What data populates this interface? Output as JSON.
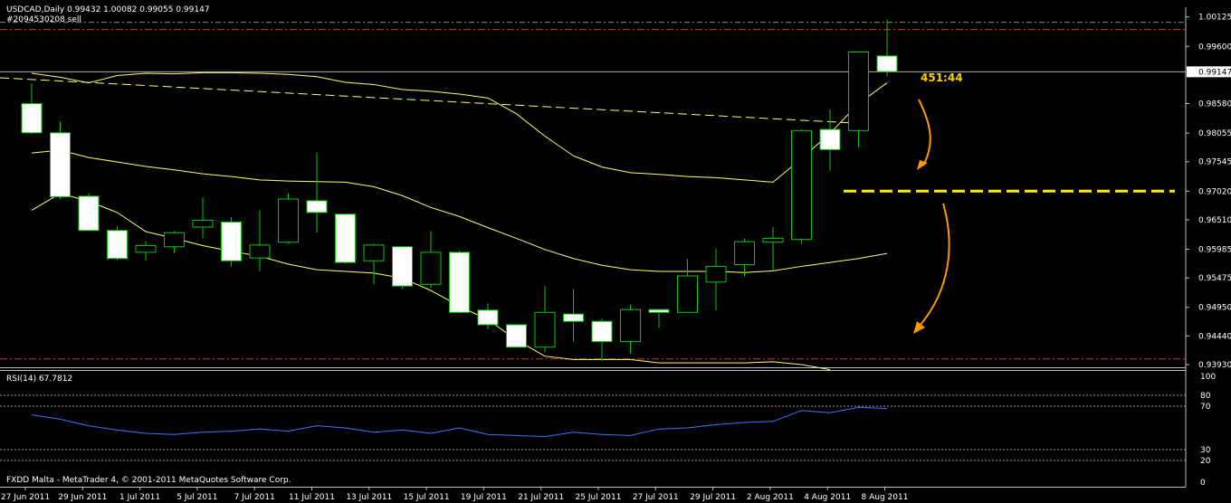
{
  "header": {
    "symbol_line": "USDCAD,Daily  0.99432 1.00082 0.99055 0.99147",
    "order_line": "#2094530208 sell"
  },
  "annotation": {
    "countdown": "451:44"
  },
  "footer": {
    "copyright": "FXDD Malta - MetaTrader 4, © 2001-2011 MetaQuotes Software Corp."
  },
  "rsi": {
    "label": "RSI(14) 67.7812"
  },
  "colors": {
    "background": "#000000",
    "bull_outline": "#00c800",
    "bear_fill": "#ffffff",
    "bands": "#ffff66",
    "levels_red": "#d03030",
    "arrows": "#ff9900",
    "rsi_line": "#3a74ff",
    "countdown": "#ffcc00"
  },
  "chart_data": [
    {
      "type": "candlestick",
      "title": "USDCAD,Daily",
      "ylim": [
        0.9393,
        1.0012
      ],
      "y_ticks": [
        "1.00125",
        "0.99600",
        "0.99147",
        "0.98580",
        "0.98055",
        "0.97545",
        "0.97020",
        "0.96510",
        "0.95985",
        "0.95475",
        "0.94950",
        "0.94440",
        "0.93930"
      ],
      "current_price": 0.99147,
      "x_tick_labels": [
        "27 Jun 2011",
        "29 Jun 2011",
        "1 Jul 2011",
        "5 Jul 2011",
        "7 Jul 2011",
        "11 Jul 2011",
        "13 Jul 2011",
        "15 Jul 2011",
        "19 Jul 2011",
        "21 Jul 2011",
        "25 Jul 2011",
        "27 Jul 2011",
        "29 Jul 2011",
        "2 Aug 2011",
        "4 Aug 2011",
        "8 Aug 2011"
      ],
      "candles": [
        {
          "o": 0.9858,
          "h": 0.9894,
          "l": 0.9804,
          "c": 0.9806
        },
        {
          "o": 0.9806,
          "h": 0.9826,
          "l": 0.9688,
          "c": 0.9692
        },
        {
          "o": 0.9693,
          "h": 0.9698,
          "l": 0.9631,
          "c": 0.9632
        },
        {
          "o": 0.9632,
          "h": 0.964,
          "l": 0.9579,
          "c": 0.9582
        },
        {
          "o": 0.9593,
          "h": 0.9613,
          "l": 0.9578,
          "c": 0.9605
        },
        {
          "o": 0.9603,
          "h": 0.9631,
          "l": 0.9592,
          "c": 0.9628
        },
        {
          "o": 0.9638,
          "h": 0.9691,
          "l": 0.9618,
          "c": 0.965
        },
        {
          "o": 0.9647,
          "h": 0.9656,
          "l": 0.9568,
          "c": 0.9578
        },
        {
          "o": 0.9583,
          "h": 0.9668,
          "l": 0.9559,
          "c": 0.9606
        },
        {
          "o": 0.9611,
          "h": 0.9698,
          "l": 0.9608,
          "c": 0.9688
        },
        {
          "o": 0.9685,
          "h": 0.9771,
          "l": 0.9628,
          "c": 0.9664
        },
        {
          "o": 0.9661,
          "h": 0.9661,
          "l": 0.9573,
          "c": 0.9575
        },
        {
          "o": 0.9578,
          "h": 0.9608,
          "l": 0.9536,
          "c": 0.9606
        },
        {
          "o": 0.9603,
          "h": 0.9603,
          "l": 0.9528,
          "c": 0.9533
        },
        {
          "o": 0.9536,
          "h": 0.9631,
          "l": 0.9529,
          "c": 0.9593
        },
        {
          "o": 0.9593,
          "h": 0.9596,
          "l": 0.9484,
          "c": 0.9486
        },
        {
          "o": 0.949,
          "h": 0.9502,
          "l": 0.9456,
          "c": 0.9464
        },
        {
          "o": 0.9464,
          "h": 0.9464,
          "l": 0.9424,
          "c": 0.9424
        },
        {
          "o": 0.9424,
          "h": 0.9533,
          "l": 0.9415,
          "c": 0.9486
        },
        {
          "o": 0.9483,
          "h": 0.9528,
          "l": 0.9434,
          "c": 0.947
        },
        {
          "o": 0.947,
          "h": 0.9475,
          "l": 0.94,
          "c": 0.9434
        },
        {
          "o": 0.9434,
          "h": 0.95,
          "l": 0.9413,
          "c": 0.9491
        },
        {
          "o": 0.9491,
          "h": 0.9491,
          "l": 0.9458,
          "c": 0.9486
        },
        {
          "o": 0.9486,
          "h": 0.9581,
          "l": 0.9486,
          "c": 0.9551
        },
        {
          "o": 0.954,
          "h": 0.96,
          "l": 0.949,
          "c": 0.9568
        },
        {
          "o": 0.9571,
          "h": 0.9618,
          "l": 0.955,
          "c": 0.9612
        },
        {
          "o": 0.9611,
          "h": 0.9638,
          "l": 0.9561,
          "c": 0.9618
        },
        {
          "o": 0.9616,
          "h": 0.9812,
          "l": 0.9608,
          "c": 0.981
        },
        {
          "o": 0.9812,
          "h": 0.9848,
          "l": 0.9738,
          "c": 0.9776
        },
        {
          "o": 0.981,
          "h": 0.995,
          "l": 0.978,
          "c": 0.995
        },
        {
          "o": 0.9943,
          "h": 1.0008,
          "l": 0.9906,
          "c": 0.9915
        }
      ],
      "upper_band": [
        0.9912,
        0.9905,
        0.9895,
        0.9908,
        0.9912,
        0.9911,
        0.9913,
        0.9913,
        0.9912,
        0.991,
        0.9906,
        0.9896,
        0.9892,
        0.9883,
        0.988,
        0.9875,
        0.9868,
        0.984,
        0.98,
        0.9765,
        0.9745,
        0.9735,
        0.9732,
        0.9728,
        0.9726,
        0.9722,
        0.9718,
        0.976,
        0.9805,
        0.9858,
        0.9895
      ],
      "middle_band": [
        0.977,
        0.9775,
        0.9762,
        0.9754,
        0.9746,
        0.974,
        0.9733,
        0.9728,
        0.9722,
        0.972,
        0.9719,
        0.9718,
        0.971,
        0.9694,
        0.9673,
        0.9657,
        0.9637,
        0.9618,
        0.9598,
        0.9582,
        0.957,
        0.9562,
        0.9559,
        0.9559,
        0.9559,
        0.9557,
        0.956,
        0.9568,
        0.9575,
        0.9582,
        0.9591
      ],
      "lower_band": [
        0.9668,
        0.9698,
        0.9684,
        0.9664,
        0.963,
        0.9618,
        0.9605,
        0.9595,
        0.9586,
        0.9572,
        0.9562,
        0.9559,
        0.9556,
        0.9547,
        0.9525,
        0.9497,
        0.9473,
        0.9437,
        0.9408,
        0.9402,
        0.9402,
        0.9402,
        0.9396,
        0.9396,
        0.9396,
        0.9396,
        0.9398,
        0.9393,
        0.9384
      ],
      "ma_dashed": {
        "from": 0.9904,
        "to": 0.9823
      },
      "sell_level": 0.9702,
      "red_lines": [
        0.999,
        0.9403
      ],
      "top_dash_line": 1.0003,
      "rsi": {
        "ylim": [
          0,
          100
        ],
        "levels": [
          80,
          70,
          30,
          20
        ],
        "tick_labels": [
          "100",
          "80",
          "70",
          "30",
          "20",
          "0"
        ],
        "values": [
          62,
          58,
          52,
          48,
          45,
          44,
          46,
          47,
          49,
          47,
          52,
          50,
          46,
          48,
          45,
          50,
          44,
          43,
          42,
          46,
          44,
          43,
          49,
          50,
          53,
          55,
          56,
          66,
          64,
          69,
          67.8
        ]
      }
    }
  ]
}
